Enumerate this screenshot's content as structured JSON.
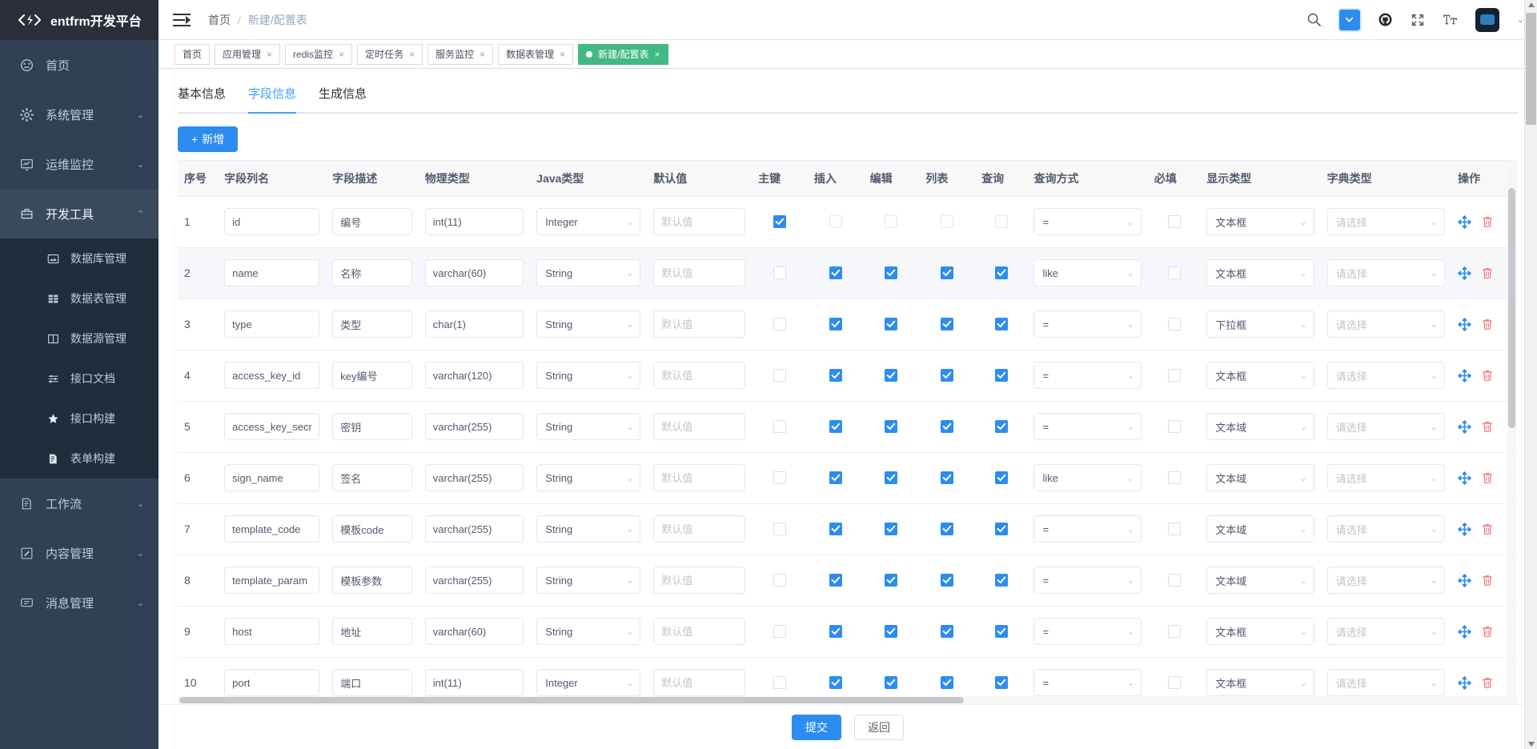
{
  "brand": {
    "title": "entfrm开发平台",
    "logo_icon": "code-brackets-icon"
  },
  "sidebar": {
    "items": [
      {
        "label": "首页",
        "icon": "dashboard-icon",
        "arrow": "",
        "state": "normal"
      },
      {
        "label": "系统管理",
        "icon": "gear-icon",
        "arrow": "⌄",
        "state": "normal"
      },
      {
        "label": "运维监控",
        "icon": "monitor-icon",
        "arrow": "⌄",
        "state": "normal"
      },
      {
        "label": "开发工具",
        "icon": "toolbox-icon",
        "arrow": "⌃",
        "state": "open"
      },
      {
        "label": "工作流",
        "icon": "flow-doc-icon",
        "arrow": "⌄",
        "state": "normal"
      },
      {
        "label": "内容管理",
        "icon": "edit-doc-icon",
        "arrow": "⌄",
        "state": "normal"
      },
      {
        "label": "消息管理",
        "icon": "message-icon",
        "arrow": "⌄",
        "state": "normal"
      }
    ],
    "submenu": [
      {
        "label": "数据库管理",
        "icon": "database-image-icon"
      },
      {
        "label": "数据表管理",
        "icon": "table-grid-icon"
      },
      {
        "label": "数据源管理",
        "icon": "columns-icon"
      },
      {
        "label": "接口文档",
        "icon": "sliders-icon"
      },
      {
        "label": "接口构建",
        "icon": "star-icon"
      },
      {
        "label": "表单构建",
        "icon": "form-doc-icon"
      }
    ]
  },
  "navbar": {
    "hamburger_icon": "hamburger-collapse-icon",
    "breadcrumb": [
      {
        "label": "首页",
        "current": false
      },
      {
        "label": "新建/配置表",
        "current": true
      }
    ],
    "separator": "/",
    "icons": [
      {
        "name": "search-icon",
        "glyph": "search"
      },
      {
        "name": "screenfull-toggle-icon",
        "glyph": "chevron-down-boxed"
      },
      {
        "name": "github-icon",
        "glyph": "github"
      },
      {
        "name": "fullscreen-icon",
        "glyph": "expand"
      },
      {
        "name": "font-size-icon",
        "glyph": "tT"
      }
    ],
    "avatar_caret": "⌄"
  },
  "tags": [
    {
      "label": "首页",
      "closable": false,
      "active": false
    },
    {
      "label": "应用管理",
      "closable": true,
      "active": false
    },
    {
      "label": "redis监控",
      "closable": true,
      "active": false
    },
    {
      "label": "定时任务",
      "closable": true,
      "active": false
    },
    {
      "label": "服务监控",
      "closable": true,
      "active": false
    },
    {
      "label": "数据表管理",
      "closable": true,
      "active": false
    },
    {
      "label": "新建/配置表",
      "closable": true,
      "active": true
    }
  ],
  "tabs": [
    {
      "label": "基本信息",
      "active": false
    },
    {
      "label": "字段信息",
      "active": true
    },
    {
      "label": "生成信息",
      "active": false
    }
  ],
  "toolbar": {
    "add_label": "新增",
    "add_icon": "plus-icon"
  },
  "table": {
    "columns": [
      "序号",
      "字段列名",
      "字段描述",
      "物理类型",
      "Java类型",
      "默认值",
      "主键",
      "插入",
      "编辑",
      "列表",
      "查询",
      "查询方式",
      "必填",
      "显示类型",
      "字典类型",
      "操作"
    ],
    "placeholders": {
      "default_value": "默认值",
      "dict_type": "请选择"
    },
    "rows": [
      {
        "seq": "1",
        "column": "id",
        "desc": "编号",
        "physical": "int(11)",
        "java": "Integer",
        "default": "",
        "pk": true,
        "pk_disabled": false,
        "insert": false,
        "edit": false,
        "list": false,
        "query": false,
        "insert_disabled": true,
        "edit_disabled": true,
        "list_disabled": true,
        "query_disabled": true,
        "query_type": "=",
        "required": false,
        "display": "文本框",
        "dict": ""
      },
      {
        "seq": "2",
        "column": "name",
        "desc": "名称",
        "physical": "varchar(60)",
        "java": "String",
        "default": "",
        "pk": false,
        "pk_disabled": false,
        "insert": true,
        "edit": true,
        "list": true,
        "query": true,
        "insert_disabled": false,
        "edit_disabled": false,
        "list_disabled": false,
        "query_disabled": false,
        "query_type": "like",
        "required": false,
        "display": "文本框",
        "dict": ""
      },
      {
        "seq": "3",
        "column": "type",
        "desc": "类型",
        "physical": "char(1)",
        "java": "String",
        "default": "",
        "pk": false,
        "pk_disabled": false,
        "insert": true,
        "edit": true,
        "list": true,
        "query": true,
        "insert_disabled": false,
        "edit_disabled": false,
        "list_disabled": false,
        "query_disabled": false,
        "query_type": "=",
        "required": false,
        "display": "下拉框",
        "dict": ""
      },
      {
        "seq": "4",
        "column": "access_key_id",
        "desc": "key编号",
        "physical": "varchar(120)",
        "java": "String",
        "default": "",
        "pk": false,
        "pk_disabled": false,
        "insert": true,
        "edit": true,
        "list": true,
        "query": true,
        "insert_disabled": false,
        "edit_disabled": false,
        "list_disabled": false,
        "query_disabled": false,
        "query_type": "=",
        "required": false,
        "display": "文本框",
        "dict": ""
      },
      {
        "seq": "5",
        "column": "access_key_secret",
        "desc": "密钥",
        "physical": "varchar(255)",
        "java": "String",
        "default": "",
        "pk": false,
        "pk_disabled": false,
        "insert": true,
        "edit": true,
        "list": true,
        "query": true,
        "insert_disabled": false,
        "edit_disabled": false,
        "list_disabled": false,
        "query_disabled": false,
        "query_type": "=",
        "required": false,
        "display": "文本域",
        "dict": ""
      },
      {
        "seq": "6",
        "column": "sign_name",
        "desc": "签名",
        "physical": "varchar(255)",
        "java": "String",
        "default": "",
        "pk": false,
        "pk_disabled": false,
        "insert": true,
        "edit": true,
        "list": true,
        "query": true,
        "insert_disabled": false,
        "edit_disabled": false,
        "list_disabled": false,
        "query_disabled": false,
        "query_type": "like",
        "required": false,
        "display": "文本域",
        "dict": ""
      },
      {
        "seq": "7",
        "column": "template_code",
        "desc": "模板code",
        "physical": "varchar(255)",
        "java": "String",
        "default": "",
        "pk": false,
        "pk_disabled": false,
        "insert": true,
        "edit": true,
        "list": true,
        "query": true,
        "insert_disabled": false,
        "edit_disabled": false,
        "list_disabled": false,
        "query_disabled": false,
        "query_type": "=",
        "required": false,
        "display": "文本域",
        "dict": ""
      },
      {
        "seq": "8",
        "column": "template_param",
        "desc": "模板参数",
        "physical": "varchar(255)",
        "java": "String",
        "default": "",
        "pk": false,
        "pk_disabled": false,
        "insert": true,
        "edit": true,
        "list": true,
        "query": true,
        "insert_disabled": false,
        "edit_disabled": false,
        "list_disabled": false,
        "query_disabled": false,
        "query_type": "=",
        "required": false,
        "display": "文本域",
        "dict": ""
      },
      {
        "seq": "9",
        "column": "host",
        "desc": "地址",
        "physical": "varchar(60)",
        "java": "String",
        "default": "",
        "pk": false,
        "pk_disabled": false,
        "insert": true,
        "edit": true,
        "list": true,
        "query": true,
        "insert_disabled": false,
        "edit_disabled": false,
        "list_disabled": false,
        "query_disabled": false,
        "query_type": "=",
        "required": false,
        "display": "文本框",
        "dict": ""
      },
      {
        "seq": "10",
        "column": "port",
        "desc": "端口",
        "physical": "int(11)",
        "java": "Integer",
        "default": "",
        "pk": false,
        "pk_disabled": false,
        "insert": true,
        "edit": true,
        "list": true,
        "query": true,
        "insert_disabled": false,
        "edit_disabled": false,
        "list_disabled": false,
        "query_disabled": false,
        "query_type": "=",
        "required": false,
        "display": "文本框",
        "dict": ""
      }
    ],
    "row_icons": {
      "move": "move-arrows-icon",
      "delete": "trash-icon"
    }
  },
  "footer": {
    "submit_label": "提交",
    "back_label": "返回"
  },
  "colors": {
    "primary": "#2d8cf0",
    "accent_tab": "#409eff",
    "active_tag": "#42b983",
    "danger": "#f56c6c",
    "sidebar": "#304156",
    "sidebar_dark": "#1f2d3d"
  }
}
